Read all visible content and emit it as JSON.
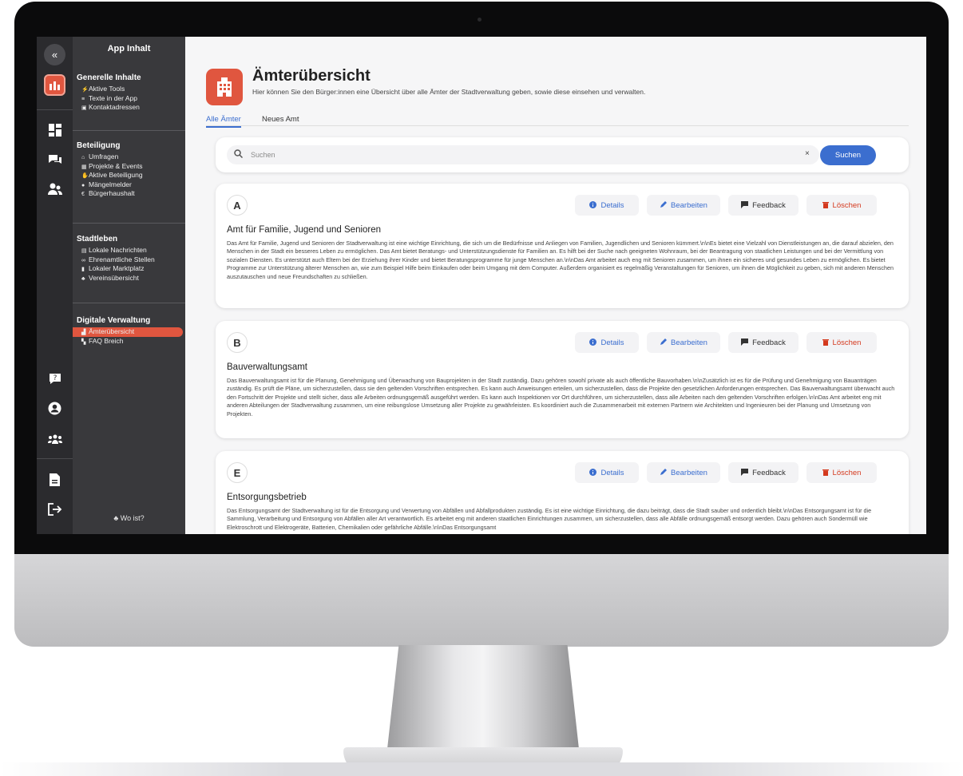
{
  "sidebar": {
    "title": "App Inhalt",
    "groups": [
      {
        "title": "Generelle Inhalte",
        "items": [
          {
            "icon": "lightning-icon",
            "glyph": "⚡",
            "label": "Aktive Tools"
          },
          {
            "icon": "lines-icon",
            "glyph": "≡",
            "label": "Texte in der App"
          },
          {
            "icon": "contact-card-icon",
            "glyph": "▣",
            "label": "Kontaktadressen"
          }
        ]
      },
      {
        "title": "Beteiligung",
        "items": [
          {
            "icon": "poll-icon",
            "glyph": "⌂",
            "label": "Umfragen"
          },
          {
            "icon": "calendar-icon",
            "glyph": "▦",
            "label": "Projekte & Events"
          },
          {
            "icon": "hand-icon",
            "glyph": "✋",
            "label": "Aktive Beteiligung"
          },
          {
            "icon": "alert-icon",
            "glyph": "●",
            "label": "Mängelmelder"
          },
          {
            "icon": "euro-icon",
            "glyph": "€",
            "label": "Bürgerhaushalt"
          }
        ]
      },
      {
        "title": "Stadtleben",
        "items": [
          {
            "icon": "news-icon",
            "glyph": "▤",
            "label": "Lokale Nachrichten"
          },
          {
            "icon": "volunteer-icon",
            "glyph": "∞",
            "label": "Ehrenamtliche Stellen"
          },
          {
            "icon": "shopping-bag-icon",
            "glyph": "▮",
            "label": "Lokaler Marktplatz"
          },
          {
            "icon": "people-icon",
            "glyph": "♣",
            "label": "Vereinsübersicht"
          }
        ]
      },
      {
        "title": "Digitale Verwaltung",
        "items": [
          {
            "icon": "building-icon",
            "glyph": "▟",
            "label": "Ämterübersicht",
            "active": true
          },
          {
            "icon": "faq-icon",
            "glyph": "▚",
            "label": "FAQ Breich"
          }
        ]
      }
    ],
    "footer": {
      "icon": "people-group-icon",
      "glyph": "♣",
      "label": "Wo ist?"
    }
  },
  "header": {
    "title": "Ämterübersicht",
    "subtitle": "Hier können Sie den Bürger:innen eine Übersicht über alle Ämter der Stadtverwaltung geben, sowie diese einsehen und verwalten."
  },
  "tabs": [
    {
      "label": "Alle Ämter",
      "active": true
    },
    {
      "label": "Neues Amt",
      "active": false
    }
  ],
  "search": {
    "placeholder": "Suchen",
    "value": "",
    "button_label": "Suchen",
    "clear_glyph": "×"
  },
  "actions": {
    "details": "Details",
    "edit": "Bearbeiten",
    "feedback": "Feedback",
    "delete": "Löschen"
  },
  "offices": [
    {
      "letter": "A",
      "name": "Amt für Familie, Jugend und Senioren",
      "description": "Das Amt für Familie, Jugend und Senioren der Stadtverwaltung ist eine wichtige Einrichtung, die sich um die Bedürfnisse und Anliegen von Familien, Jugendlichen und Senioren kümmert.\\n\\nEs bietet eine Vielzahl von Dienstleistungen an, die darauf abzielen, den Menschen in der Stadt ein besseres Leben zu ermöglichen. Das Amt bietet Beratungs- und Unterstützungsdienste für Familien an. Es hilft bei der Suche nach geeigneten Wohnraum, bei der Beantragung von staatlichen Leistungen und bei der Vermittlung von sozialen Diensten. Es unterstützt auch Eltern bei der Erziehung ihrer Kinder und bietet Beratungsprogramme für junge Menschen an.\\n\\nDas Amt arbeitet auch eng mit Senioren zusammen, um ihnen ein sicheres und gesundes Leben zu ermöglichen. Es bietet Programme zur Unterstützung älterer Menschen an, wie zum Beispiel Hilfe beim Einkaufen oder beim Umgang mit dem Computer. Außerdem organisiert es regelmäßig Veranstaltungen für Senioren, um ihnen die Möglichkeit zu geben, sich mit anderen Menschen auszutauschen und neue Freundschaften zu schließen."
    },
    {
      "letter": "B",
      "name": "Bauverwaltungsamt",
      "description": "Das Bauverwaltungsamt ist für die Planung, Genehmigung und Überwachung von Bauprojekten in der Stadt zuständig. Dazu gehören sowohl private als auch öffentliche Bauvorhaben.\\n\\nZusätzlich ist es für die Prüfung und Genehmigung von Bauanträgen zuständig. Es prüft die Pläne, um sicherzustellen, dass sie den geltenden Vorschriften entsprechen. Es kann auch Anweisungen erteilen, um sicherzustellen, dass die Projekte den gesetzlichen Anforderungen entsprechen. Das Bauverwaltungsamt überwacht auch den Fortschritt der Projekte und stellt sicher, dass alle Arbeiten ordnungsgemäß ausgeführt werden. Es kann auch Inspektionen vor Ort durchführen, um sicherzustellen, dass alle Arbeiten nach den geltenden Vorschriften erfolgen.\\n\\nDas Amt arbeitet eng mit anderen Abteilungen der Stadtverwaltung zusammen, um eine reibungslose Umsetzung aller Projekte zu gewährleisten. Es koordiniert auch die Zusammenarbeit mit externen Partnern wie Architekten und Ingenieuren bei der Planung und Umsetzung von Projekten."
    },
    {
      "letter": "E",
      "name": "Entsorgungsbetrieb",
      "description": "Das Entsorgungsamt der Stadtverwaltung ist für die Entsorgung und Verwertung von Abfällen und Abfallprodukten zuständig. Es ist eine wichtige Einrichtung, die dazu beiträgt, dass die Stadt sauber und ordentlich bleibt.\\n\\nDas Entsorgungsamt ist für die Sammlung, Verarbeitung und Entsorgung von Abfällen aller Art verantwortlich. Es arbeitet eng mit anderen staatlichen Einrichtungen zusammen, um sicherzustellen, dass alle Abfälle ordnungsgemäß entsorgt werden. Dazu gehören auch Sondermüll wie Elektroschrott und Elektrogeräte, Batterien, Chemikalien oder gefährliche Abfälle.\\n\\nDas Entsorgungsamt"
    }
  ],
  "colors": {
    "accent": "#e0563f",
    "primary": "#3b6ecf",
    "danger": "#d4391e",
    "sidebar_bg": "#39393c",
    "iconbar_bg": "#2b2b2e"
  }
}
